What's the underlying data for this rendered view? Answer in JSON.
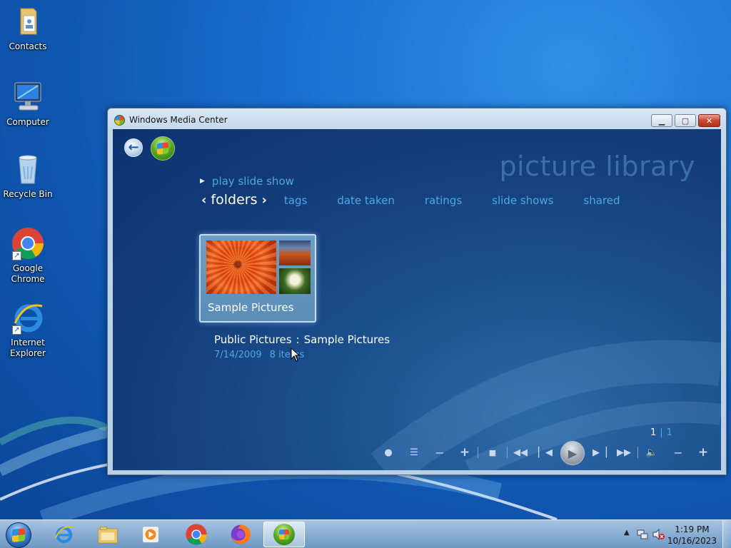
{
  "desktop": {
    "icons": [
      {
        "label": "Contacts",
        "icon": "contacts-folder-icon"
      },
      {
        "label": "Computer",
        "icon": "computer-icon"
      },
      {
        "label": "Recycle Bin",
        "icon": "recycle-bin-icon"
      },
      {
        "label": "Google Chrome",
        "icon": "chrome-icon",
        "shortcut": true
      },
      {
        "label": "Internet Explorer",
        "icon": "internet-explorer-icon",
        "shortcut": true
      }
    ]
  },
  "window": {
    "title": "Windows Media Center",
    "controls": {
      "minimize": "minimize-icon",
      "maximize": "maximize-icon",
      "close": "close-icon"
    }
  },
  "media_center": {
    "heading": "picture library",
    "play_slide_show": "play slide show",
    "tabs": {
      "active": "folders",
      "others": [
        "tags",
        "date taken",
        "ratings",
        "slide shows",
        "shared"
      ]
    },
    "tile": {
      "label": "Sample Pictures"
    },
    "info": {
      "parent": "Public Pictures",
      "separator": ":",
      "folder": "Sample Pictures",
      "date": "7/14/2009",
      "count": "8 items"
    },
    "pager": {
      "current": "1",
      "separator": "|",
      "total": "1"
    },
    "transport": [
      "record-icon",
      "guide-list-icon",
      "channel-down-icon",
      "channel-up-icon",
      "stop-icon",
      "rewind-icon",
      "skip-back-icon",
      "play-icon",
      "skip-forward-icon",
      "fast-forward-icon",
      "volume-icon",
      "volume-down-icon",
      "volume-up-icon"
    ]
  },
  "taskbar": {
    "apps": [
      "start-orb-icon",
      "internet-explorer-icon",
      "windows-explorer-icon",
      "media-player-icon",
      "chrome-icon",
      "firefox-icon",
      "media-center-icon"
    ],
    "active_app": "media-center-icon",
    "clock": {
      "time": "1:19 PM",
      "date": "10/16/2023"
    }
  },
  "colors": {
    "desktop_blue": "#1a6ecf",
    "mc_accent": "#4fa7e6",
    "mc_background": "#123c78"
  }
}
